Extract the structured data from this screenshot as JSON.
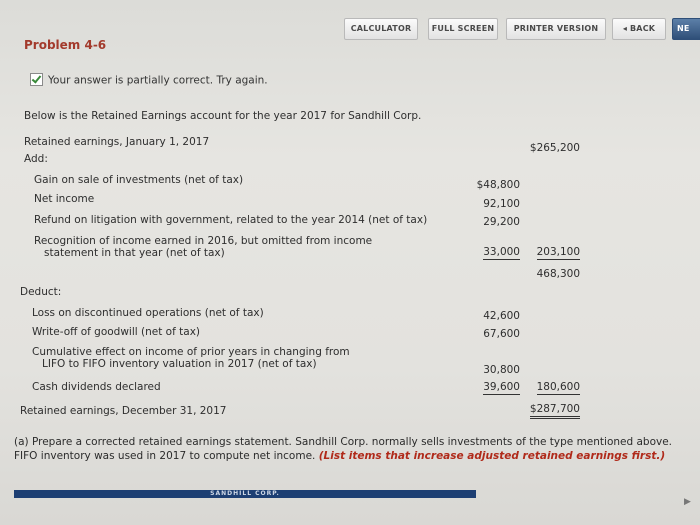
{
  "toolbar": {
    "calculator": "CALCULATOR",
    "full_screen": "FULL SCREEN",
    "printer_version": "PRINTER VERSION",
    "back": "◂ BACK",
    "next": "NE"
  },
  "problem_title": "Problem 4-6",
  "alert_text": "Your answer is partially correct.  Try again.",
  "intro": "Below is the Retained Earnings account for the year 2017 for Sandhill Corp.",
  "statement": {
    "opening": {
      "label": "Retained earnings, January 1, 2017",
      "total": "$265,200"
    },
    "add_label": "Add:",
    "add_items": [
      {
        "label": "Gain on sale of investments (net of tax)",
        "amount": "$48,800"
      },
      {
        "label": "Net income",
        "amount": "92,100"
      },
      {
        "label": "Refund on litigation with government, related to the year 2014 (net of tax)",
        "amount": "29,200"
      },
      {
        "label": "Recognition of income earned in 2016, but omitted from income",
        "label2": "statement in that year (net of tax)",
        "amount": "33,000"
      }
    ],
    "add_total": "203,100",
    "subtotal": "468,300",
    "deduct_label": "Deduct:",
    "deduct_items": [
      {
        "label": "Loss on discontinued operations (net of tax)",
        "amount": "42,600"
      },
      {
        "label": "Write-off of goodwill (net of tax)",
        "amount": "67,600"
      },
      {
        "label": "Cumulative effect on income of prior years in changing from",
        "label2": "LIFO to FIFO inventory valuation in 2017 (net of tax)",
        "amount": "30,800"
      },
      {
        "label": "Cash dividends declared",
        "amount": "39,600"
      }
    ],
    "deduct_total": "180,600",
    "closing": {
      "label": "Retained earnings, December 31, 2017",
      "total": "$287,700"
    }
  },
  "part_a": {
    "text": "(a) Prepare a corrected retained earnings statement. Sandhill Corp. normally sells investments of the type mentioned above. FIFO inventory was used in 2017 to compute net income.",
    "instruction": "(List items that increase adjusted retained earnings first.)"
  },
  "table_header": "SANDHILL CORP."
}
